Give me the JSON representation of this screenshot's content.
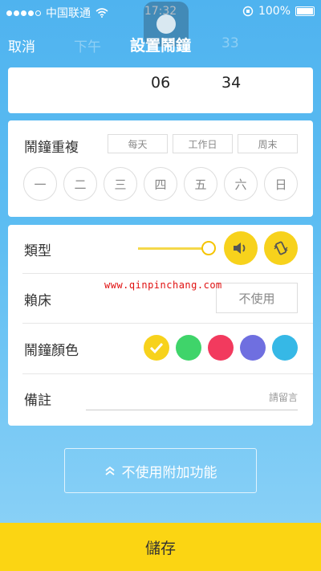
{
  "status_bar": {
    "carrier": "中国联通",
    "time": "17:32",
    "battery": "100%",
    "battery_level": 1.0
  },
  "nav": {
    "cancel": "取消",
    "title": "設置鬧鐘",
    "ghost_left": "下午",
    "ghost_right": "33"
  },
  "time_picker": {
    "hour": "06",
    "minute": "34"
  },
  "repeat": {
    "label": "鬧鐘重複",
    "chips": [
      "每天",
      "工作日",
      "周末"
    ],
    "days": [
      "一",
      "二",
      "三",
      "四",
      "五",
      "六",
      "日"
    ]
  },
  "type": {
    "label": "類型",
    "volume_level": 1.0,
    "icons": [
      "speaker-icon",
      "vibrate-icon"
    ]
  },
  "snooze": {
    "label": "賴床",
    "value": "不使用"
  },
  "color": {
    "label": "鬧鐘顏色",
    "options": [
      "#f7d21c",
      "#3fd46a",
      "#f23a5e",
      "#6f6fe0",
      "#36b8e6"
    ],
    "selected": 0
  },
  "note": {
    "label": "備註",
    "placeholder": "請留言"
  },
  "watermark": "www.qinpinchang.com",
  "extra_button": "不使用附加功能",
  "save_button": "儲存"
}
